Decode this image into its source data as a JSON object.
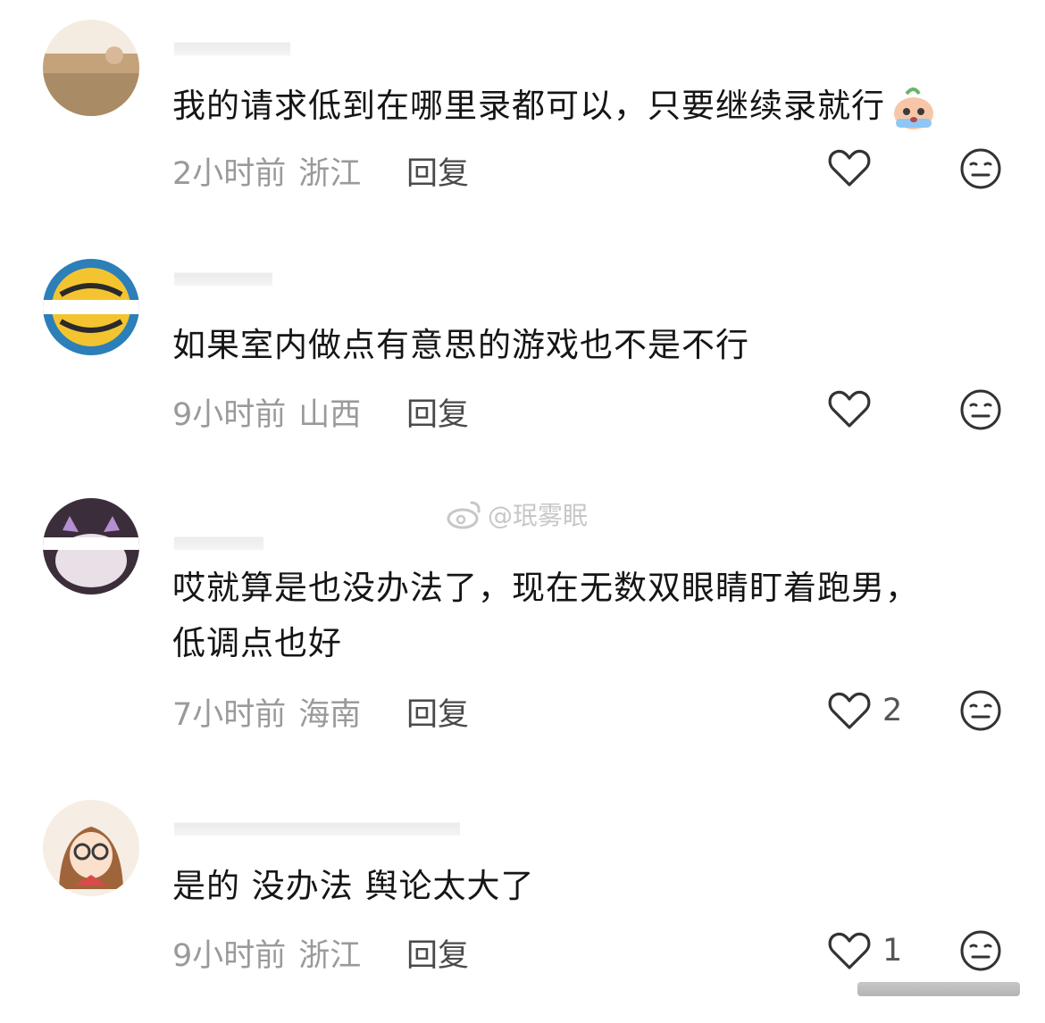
{
  "comments": [
    {
      "text": "我的请求低到在哪里录都可以，只要继续录就行",
      "emoji": "crying-emoji",
      "time": "2小时前",
      "location": "浙江",
      "reply_label": "回复",
      "likes": ""
    },
    {
      "text": "如果室内做点有意思的游戏也不是不行",
      "time": "9小时前",
      "location": "山西",
      "reply_label": "回复",
      "likes": ""
    },
    {
      "text_line1": "哎就算是也没办法了，现在无数双眼睛盯着跑男，",
      "text_line2": "低调点也好",
      "time": "7小时前",
      "location": "海南",
      "reply_label": "回复",
      "likes": "2"
    },
    {
      "text": "是的 没办法 舆论太大了",
      "time": "9小时前",
      "location": "浙江",
      "reply_label": "回复",
      "likes": "1"
    }
  ],
  "watermark": "@珉雾眠",
  "icons": {
    "like": "heart-outline-icon",
    "dislike": "neutral-face-icon",
    "watermark_logo": "weibo-logo-icon"
  },
  "colors": {
    "text": "#151515",
    "meta": "#9a9a9a",
    "icon": "#333333"
  }
}
